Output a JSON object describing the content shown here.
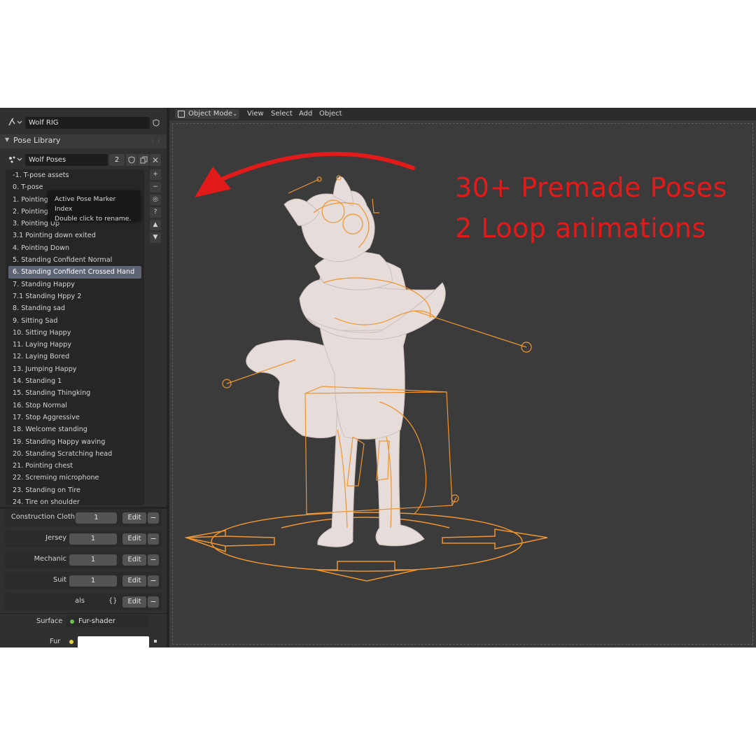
{
  "rig": {
    "name": "Wolf RIG"
  },
  "pose_library": {
    "title": "Pose Library",
    "library_name": "Wolf Poses",
    "user_count": "2",
    "items": [
      "-1. T-pose assets",
      "0. T-pose",
      "1. Pointing",
      "2. Pointing R",
      "3. Pointing Up",
      "3.1 Pointing down exited",
      "4. Pointing Down",
      "5. Standing Confident Normal",
      "6. Standing Confident Crossed Hand",
      "7. Standing Happy",
      "7.1 Standing Hppy 2",
      "8. Standing sad",
      "9. Sitting Sad",
      "10. Sitting Happy",
      "11. Laying Happy",
      "12. Laying Bored",
      "13. Jumping Happy",
      "14. Standing 1",
      "15. Standing Thingking",
      "16. Stop Normal",
      "17. Stop Aggressive",
      "18. Welcome standing",
      "19. Standing Happy waving",
      "20. Standing Scratching head",
      "21. Pointing chest",
      "22. Screming microphone",
      "23. Standing on Tire",
      "24. Tire on shoulder"
    ],
    "selected_index": 8,
    "tooltip": {
      "line1": "Active Pose Marker Index",
      "line2": "Double click to rename."
    },
    "side_buttons": [
      "+",
      "−",
      "◎",
      "?",
      "▲",
      "▼"
    ]
  },
  "properties": {
    "rows": [
      {
        "label": "Construction Cloth",
        "value": "1",
        "edit": "Edit"
      },
      {
        "label": "Jersey",
        "value": "1",
        "edit": "Edit"
      },
      {
        "label": "Mechanic",
        "value": "1",
        "edit": "Edit"
      },
      {
        "label": "Suit",
        "value": "1",
        "edit": "Edit"
      },
      {
        "label": "als",
        "value": "{}",
        "edit": "Edit"
      }
    ],
    "minus": "−"
  },
  "surface": {
    "surface_label": "Surface",
    "surface_value": "Fur-shader",
    "fur_label": "Fur",
    "surface_dot_color": "#6cc24a",
    "fur_dot_color": "#e3d33a"
  },
  "viewport": {
    "mode": "Object Mode",
    "menu": [
      "View",
      "Select",
      "Add",
      "Object"
    ]
  },
  "promo": {
    "line1": "30+ Premade Poses",
    "line2": "2 Loop animations",
    "color": "#e21a1a"
  },
  "colors": {
    "rig_orange": "#f0952f",
    "wolf_fur": "#e6dcd9",
    "selection": "#5d6474"
  }
}
